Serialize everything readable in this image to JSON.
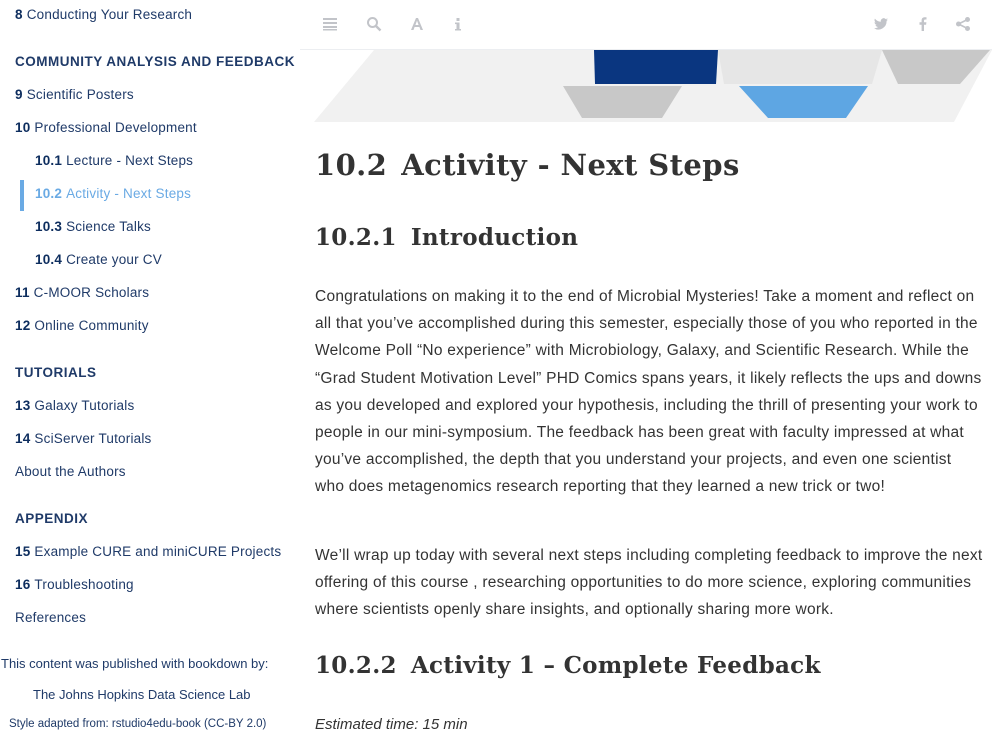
{
  "sidebar": {
    "items": [
      {
        "num": "8",
        "label": "Conducting Your Research"
      },
      {
        "section": "COMMUNITY ANALYSIS AND FEEDBACK"
      },
      {
        "num": "9",
        "label": "Scientific Posters"
      },
      {
        "num": "10",
        "label": "Professional Development"
      },
      {
        "num": "10.1",
        "label": "Lecture - Next Steps"
      },
      {
        "num": "10.2",
        "label": "Activity - Next Steps"
      },
      {
        "num": "10.3",
        "label": "Science Talks"
      },
      {
        "num": "10.4",
        "label": "Create your CV"
      },
      {
        "num": "11",
        "label": "C-MOOR Scholars"
      },
      {
        "num": "12",
        "label": "Online Community"
      },
      {
        "section": "TUTORIALS"
      },
      {
        "num": "13",
        "label": "Galaxy Tutorials"
      },
      {
        "num": "14",
        "label": "SciServer Tutorials"
      },
      {
        "label": "About the Authors"
      },
      {
        "section": "APPENDIX"
      },
      {
        "num": "15",
        "label": "Example CURE and miniCURE Projects"
      },
      {
        "num": "16",
        "label": "Troubleshooting"
      },
      {
        "label": "References"
      }
    ],
    "published_line": "This content was published with bookdown by:",
    "lab_line": "The Johns Hopkins Data Science Lab",
    "style_line": "Style adapted from: rstudio4edu-book (CC-BY 2.0)"
  },
  "toolbar": {
    "left_icons": [
      "toc-toggle-icon",
      "search-icon",
      "font-settings-icon",
      "info-icon"
    ],
    "right_icons": [
      "twitter-icon",
      "facebook-icon",
      "share-icon"
    ]
  },
  "colors": {
    "navy": "#0d2d5e",
    "link": "#1f3a68",
    "active": "#6aaae4",
    "banner_navy": "#0a3680",
    "banner_blue": "#5ea6e3",
    "banner_gray": "#c8c8c8",
    "banner_light": "#e6e6e6"
  },
  "content": {
    "h1": {
      "num": "10.2",
      "text": "Activity - Next Steps"
    },
    "intro_heading": {
      "num": "10.2.1",
      "text": "Introduction"
    },
    "para1": "Congratulations on making it to the end of Microbial Mysteries! Take a moment and reflect on all that you’ve accomplished during this semester, especially those of you who reported in the Welcome Poll “No experience” with Microbiology, Galaxy, and Scientific Research. While the “Grad Student Motivation Level” PHD Comics spans years, it likely reflects the ups and downs as you developed and explored your hypothesis, including the thrill of presenting your work to people in our mini-symposium. The feedback has been great with faculty impressed at what you’ve accomplished, the depth that you understand your projects, and even one scientist who does metagenomics research reporting that they learned a new trick or two!",
    "para2": "We’ll wrap up today with several next steps including completing feedback to improve the next offering of this course , researching opportunities to do more science, exploring communities where scientists openly share insights, and optionally sharing more work.",
    "activity_heading": {
      "num": "10.2.2",
      "text": "Activity 1 – Complete Feedback"
    },
    "estimated": "Estimated time: 15 min"
  }
}
